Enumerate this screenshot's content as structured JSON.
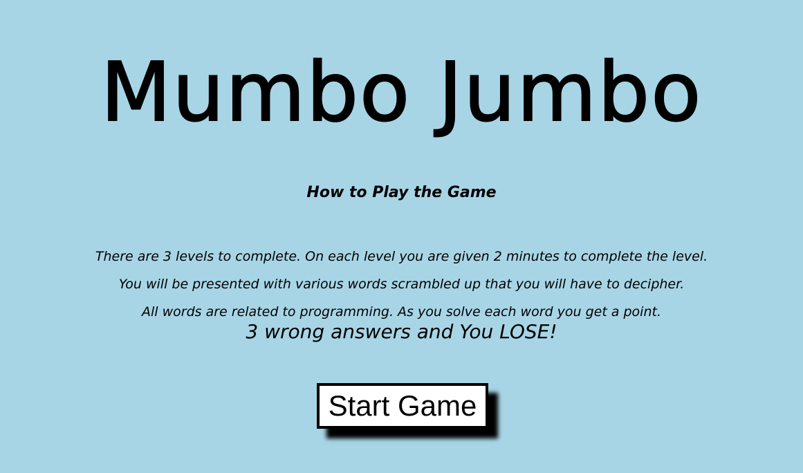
{
  "page": {
    "background_color": "#a8d5e5"
  },
  "header": {
    "title": "Mumbo Jumbo"
  },
  "instructions": {
    "heading": "How to Play the Game",
    "lines": [
      "There are 3 levels to complete. On each level you are given 2 minutes to complete the level.",
      "You will be presented with various words scrambled up that you will have to decipher.",
      "All words are related to programming. As you solve each word you get a point."
    ],
    "warning": "3 wrong answers and You LOSE!"
  },
  "actions": {
    "start_label": "Start Game"
  }
}
